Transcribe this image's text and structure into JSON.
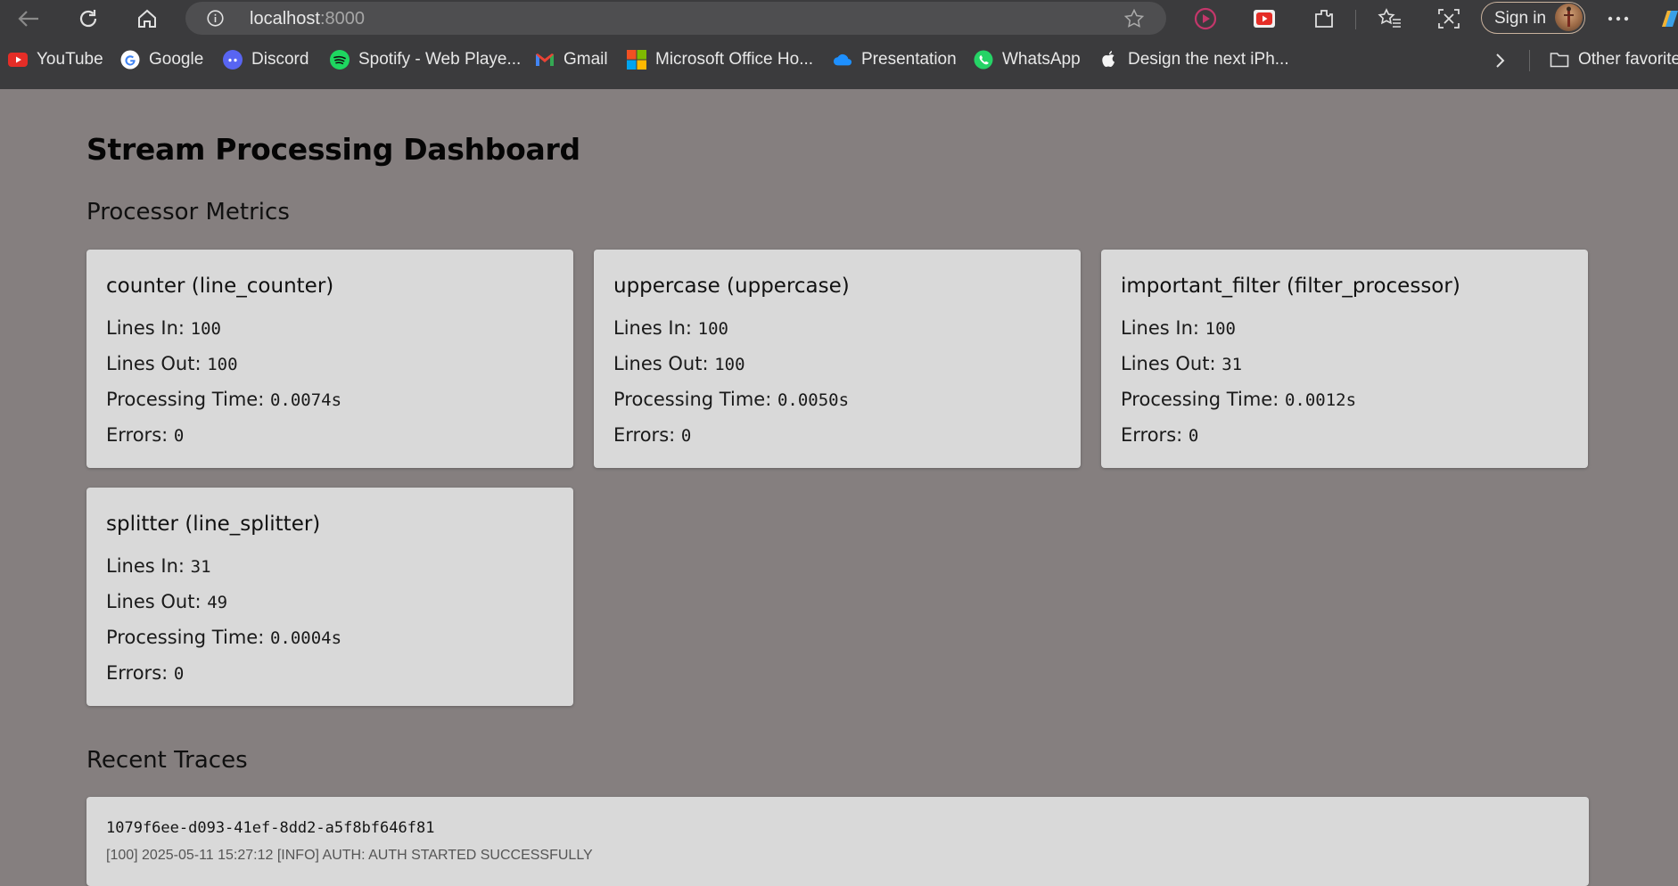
{
  "browser": {
    "url_host": "localhost",
    "url_port": ":8000",
    "signin_label": "Sign in",
    "bookmarks": [
      {
        "label": "YouTube",
        "icon": "youtube-icon"
      },
      {
        "label": "Google",
        "icon": "google-icon"
      },
      {
        "label": "Discord",
        "icon": "discord-icon"
      },
      {
        "label": "Spotify - Web Playe...",
        "icon": "spotify-icon"
      },
      {
        "label": "Gmail",
        "icon": "gmail-icon"
      },
      {
        "label": "Microsoft Office Ho...",
        "icon": "microsoft-icon"
      },
      {
        "label": "Presentation",
        "icon": "onedrive-icon"
      },
      {
        "label": "WhatsApp",
        "icon": "whatsapp-icon"
      },
      {
        "label": "Design the next iPh...",
        "icon": "apple-icon"
      }
    ],
    "other_favorites": "Other favorites"
  },
  "page": {
    "title": "Stream Processing Dashboard",
    "metrics_heading": "Processor Metrics",
    "traces_heading": "Recent Traces"
  },
  "labels": {
    "lines_in": "Lines In:",
    "lines_out": "Lines Out:",
    "processing_time": "Processing Time:",
    "errors": "Errors:"
  },
  "processors": [
    {
      "title": "counter (line_counter)",
      "lines_in": "100",
      "lines_out": "100",
      "processing_time": "0.0074s",
      "errors": "0"
    },
    {
      "title": "uppercase (uppercase)",
      "lines_in": "100",
      "lines_out": "100",
      "processing_time": "0.0050s",
      "errors": "0"
    },
    {
      "title": "important_filter (filter_processor)",
      "lines_in": "100",
      "lines_out": "31",
      "processing_time": "0.0012s",
      "errors": "0"
    },
    {
      "title": "splitter (line_splitter)",
      "lines_in": "31",
      "lines_out": "49",
      "processing_time": "0.0004s",
      "errors": "0"
    }
  ],
  "traces": [
    {
      "id": "1079f6ee-d093-41ef-8dd2-a5f8bf646f81",
      "line": "[100] 2025-05-11 15:27:12 [INFO] AUTH: AUTH STARTED SUCCESSFULLY"
    }
  ]
}
